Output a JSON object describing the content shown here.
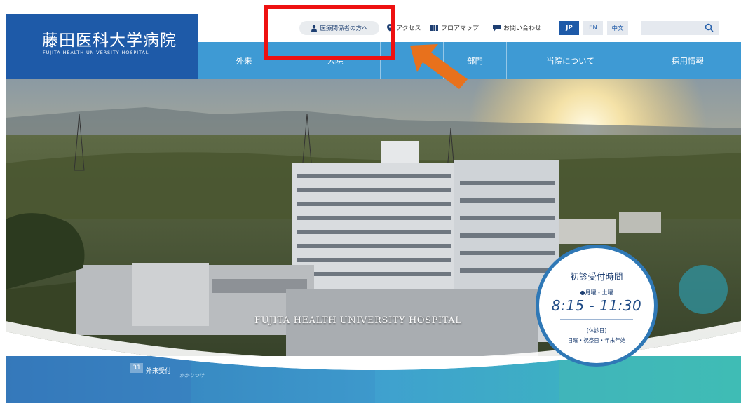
{
  "header": {
    "logo": {
      "title": "藤田医科大学病院",
      "subtitle": "FUJITA HEALTH UNIVERSITY HOSPITAL"
    },
    "utility": {
      "medical_professionals": "医療関係者の方へ",
      "access": "アクセス",
      "floor_map": "フロアマップ",
      "contact": "お問い合わせ",
      "languages": [
        "JP",
        "EN",
        "中文"
      ],
      "search_placeholder": ""
    },
    "nav": [
      "外来",
      "入院",
      "",
      "部門",
      "当院について",
      "採用情報"
    ]
  },
  "hero": {
    "tagline": "FUJITA HEALTH UNIVERSITY HOSPITAL",
    "hours": {
      "title": "初診受付時間",
      "days": "●月曜 - 土曜",
      "time": "8:15 - 11:30",
      "closed_label": "[休診日]",
      "closed": "日曜・祝祭日・年末年始"
    },
    "bottom_tiles": {
      "number": "31",
      "label": "外来受付",
      "subtext": "かかりつけ"
    }
  },
  "colors": {
    "brand_blue": "#1e5aa8",
    "nav_blue": "#3e9ad4",
    "annotation_red": "#ee1111",
    "annotation_orange": "#e8711c"
  }
}
